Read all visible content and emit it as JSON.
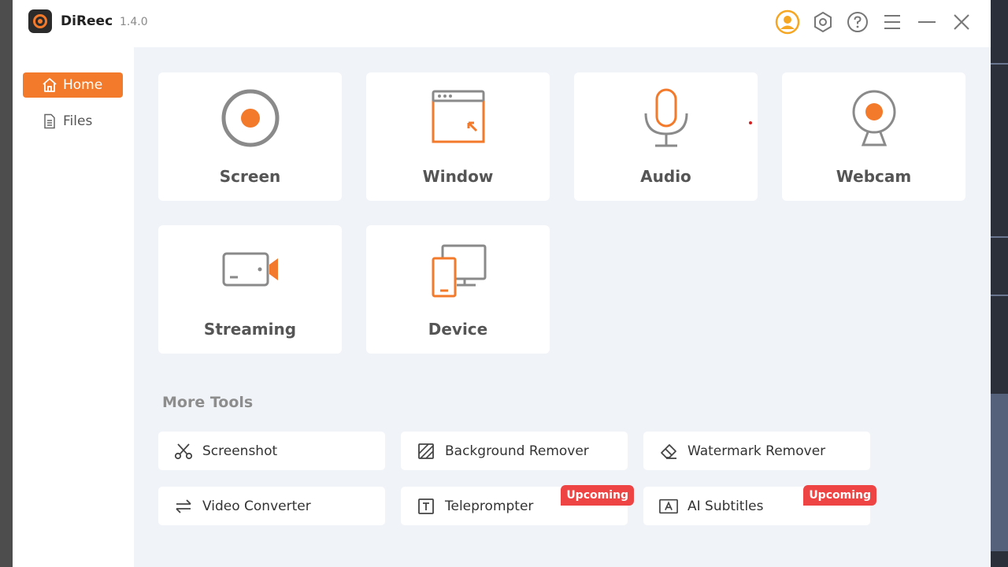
{
  "app": {
    "name": "DiReec",
    "version": "1.4.0"
  },
  "sidebar": {
    "items": [
      {
        "label": "Home",
        "icon": "home-icon",
        "active": true
      },
      {
        "label": "Files",
        "icon": "file-icon",
        "active": false
      }
    ]
  },
  "record_modes": [
    {
      "label": "Screen",
      "icon": "screen-record-icon"
    },
    {
      "label": "Window",
      "icon": "window-icon"
    },
    {
      "label": "Audio",
      "icon": "microphone-icon"
    },
    {
      "label": "Webcam",
      "icon": "webcam-icon"
    },
    {
      "label": "Streaming",
      "icon": "streaming-camera-icon"
    },
    {
      "label": "Device",
      "icon": "device-icon"
    }
  ],
  "more_tools": {
    "title": "More Tools",
    "items": [
      {
        "label": "Screenshot",
        "icon": "scissors-icon"
      },
      {
        "label": "Background Remover",
        "icon": "background-remover-icon"
      },
      {
        "label": "Watermark Remover",
        "icon": "eraser-icon"
      },
      {
        "label": "Video Converter",
        "icon": "convert-arrows-icon"
      },
      {
        "label": "Teleprompter",
        "icon": "teleprompter-icon",
        "badge": "Upcoming"
      },
      {
        "label": "AI Subtitles",
        "icon": "subtitles-icon",
        "badge": "Upcoming"
      }
    ]
  },
  "colors": {
    "accent": "#f47a2b",
    "badge": "#ef4444",
    "background": "#f0f3f8",
    "icon_gray": "#8a8a8a"
  }
}
